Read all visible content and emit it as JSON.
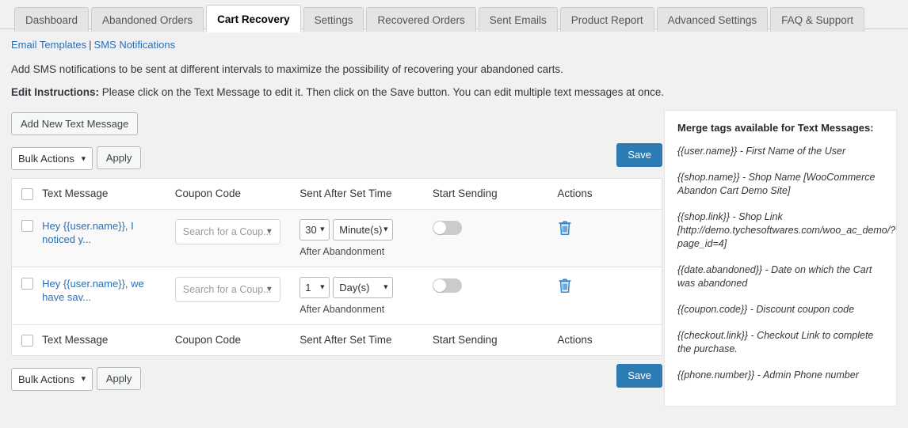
{
  "tabs": [
    {
      "label": "Dashboard",
      "active": false
    },
    {
      "label": "Abandoned Orders",
      "active": false
    },
    {
      "label": "Cart Recovery",
      "active": true
    },
    {
      "label": "Settings",
      "active": false
    },
    {
      "label": "Recovered Orders",
      "active": false
    },
    {
      "label": "Sent Emails",
      "active": false
    },
    {
      "label": "Product Report",
      "active": false
    },
    {
      "label": "Advanced Settings",
      "active": false
    },
    {
      "label": "FAQ & Support",
      "active": false
    }
  ],
  "subnav": {
    "email_templates": "Email Templates",
    "separator": "|",
    "sms_notifications": "SMS Notifications"
  },
  "lede": "Add SMS notifications to be sent at different intervals to maximize the possibility of recovering your abandoned carts.",
  "instructions": {
    "label": "Edit Instructions:",
    "text": "Please click on the Text Message to edit it. Then click on the Save button. You can edit multiple text messages at once."
  },
  "toolbar": {
    "add_new_label": "Add New Text Message",
    "bulk_actions_label": "Bulk Actions",
    "apply_label": "Apply",
    "save_label": "Save"
  },
  "table": {
    "columns": {
      "text_message": "Text Message",
      "coupon_code": "Coupon Code",
      "sent_after": "Sent After Set Time",
      "start_sending": "Start Sending",
      "actions": "Actions"
    },
    "rows": [
      {
        "message": "Hey {{user.name}}, I noticed y...",
        "coupon_placeholder": "Search for a Coup...",
        "time_value": "30",
        "time_unit": "Minute(s)",
        "after_label": "After Abandonment",
        "sending_enabled": false,
        "action_icon": "trash-icon"
      },
      {
        "message": "Hey {{user.name}}, we have sav...",
        "coupon_placeholder": "Search for a Coup...",
        "time_value": "1",
        "time_unit": "Day(s)",
        "after_label": "After Abandonment",
        "sending_enabled": false,
        "action_icon": "trash-icon"
      }
    ]
  },
  "merge_panel": {
    "title": "Merge tags available for Text Messages:",
    "items": [
      "{{user.name}} - First Name of the User",
      "{{shop.name}} - Shop Name [WooCommerce Abandon Cart Demo Site]",
      "{{shop.link}} - Shop Link [http://demo.tychesoftwares.com/woo_ac_demo/?page_id=4]",
      "{{date.abandoned}} - Date on which the Cart was abandoned",
      "{{coupon.code}} - Discount coupon code",
      "{{checkout.link}} - Checkout Link to complete the purchase.",
      "{{phone.number}} - Admin Phone number"
    ]
  },
  "icons": {
    "caret_down": "▼"
  },
  "colors": {
    "accent_blue": "#2b7cb3",
    "link_blue": "#2a6fb3",
    "page_bg": "#f1f1f1"
  }
}
